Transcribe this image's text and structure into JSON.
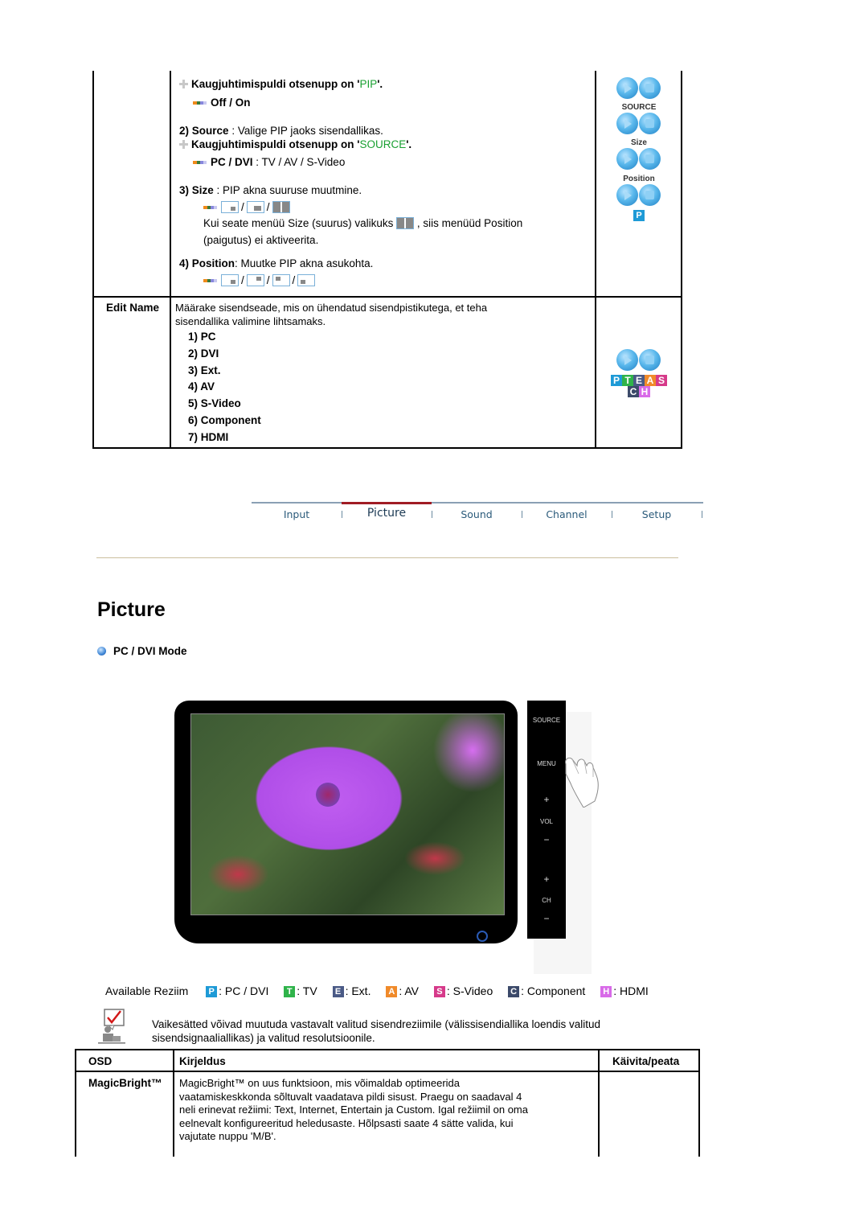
{
  "pip_section": {
    "remote_note_pip_prefix": "Kaugjuhtimispuldi otsenupp on '",
    "remote_note_pip_key": "PIP",
    "remote_note_suffix": "'.",
    "off_on": "Off / On",
    "source_num": "2)",
    "source_label": "Source",
    "source_desc": " : Valige PIP jaoks sisendallikas.",
    "remote_note_source_prefix": "Kaugjuhtimispuldi otsenupp on '",
    "remote_note_source_key": "SOURCE",
    "source_options_bold": "PC / DVI",
    "source_options_rest": " : TV / AV / S-Video",
    "size_num": "3)",
    "size_label": "Size",
    "size_desc": " : PIP akna suuruse muutmine.",
    "size_note_a": "Kui seate menüü Size (suurus) valikuks",
    "size_note_b": ", siis menüüd Position",
    "size_note_c": "(paigutus) ei aktiveerita.",
    "position_num": "4)",
    "position_label": "Position",
    "position_desc": ": Muutke PIP akna asukohta.",
    "slash": "/",
    "side_buttons": {
      "caption_1": "SOURCE",
      "caption_2": "Size",
      "caption_3": "Position",
      "badge": "P"
    }
  },
  "edit_name": {
    "label": "Edit Name",
    "desc_line1": "Määrake sisendseade, mis on ühendatud sisendpistikutega, et teha",
    "desc_line2": "sisendallika valimine lihtsamaks.",
    "items": [
      "1) PC",
      "2) DVI",
      "3) Ext.",
      "4) AV",
      "5) S-Video",
      "6) Component",
      "7) HDMI"
    ],
    "badges_row1": [
      "P",
      "T",
      "E",
      "A",
      "S"
    ],
    "badges_row2": [
      "C",
      "H"
    ]
  },
  "nav": {
    "tabs": [
      "Input",
      "Picture",
      "Sound",
      "Channel",
      "Setup"
    ],
    "active": "Picture"
  },
  "page": {
    "title": "Picture",
    "mode_heading": "PC / DVI Mode"
  },
  "monitor": {
    "side_buttons": [
      "SOURCE",
      "MENU",
      "+",
      "VOL",
      "−",
      "+",
      "CH",
      "−"
    ]
  },
  "available_modes": {
    "label": "Available Reziim",
    "items": [
      {
        "badge": "P",
        "text": ": PC / DVI",
        "color": "#1e9ad6"
      },
      {
        "badge": "T",
        "text": ": TV",
        "color": "#2fb34a"
      },
      {
        "badge": "E",
        "text": ": Ext.",
        "color": "#4a5a86"
      },
      {
        "badge": "A",
        "text": ": AV",
        "color": "#f08a2a"
      },
      {
        "badge": "S",
        "text": ": S-Video",
        "color": "#d63a8a"
      },
      {
        "badge": "C",
        "text": ": Component",
        "color": "#3c4a6a"
      },
      {
        "badge": "H",
        "text": ": HDMI",
        "color": "#d86ae8"
      }
    ]
  },
  "note": {
    "line1": "Vaikesätted võivad muutuda vastavalt valitud sisendreziimile (välissisendiallika loendis valitud",
    "line2": "sisendsignaaliallikas) ja valitud resolutsioonile."
  },
  "osd_table": {
    "headers": [
      "OSD",
      "Kirjeldus",
      "Käivita/peata"
    ],
    "rows": [
      {
        "osd": "MagicBright™",
        "desc_lines": [
          "MagicBright™ on uus funktsioon, mis võimaldab optimeerida",
          "vaatamiskeskkonda sõltuvalt vaadatava pildi sisust. Praegu on saadaval 4",
          "neli erinevat režiimi: Text, Internet, Entertain ja Custom. Igal režiimil on oma",
          "eelnevalt konfigureeritud heledusaste. Hõlpsasti saate 4 sätte valida, kui",
          "vajutate nuppu 'M/B'."
        ]
      }
    ]
  },
  "colors": {
    "highlight_green": "#1aa032",
    "nav_active": "#a01c24",
    "nav_text": "#2a5a7a"
  }
}
